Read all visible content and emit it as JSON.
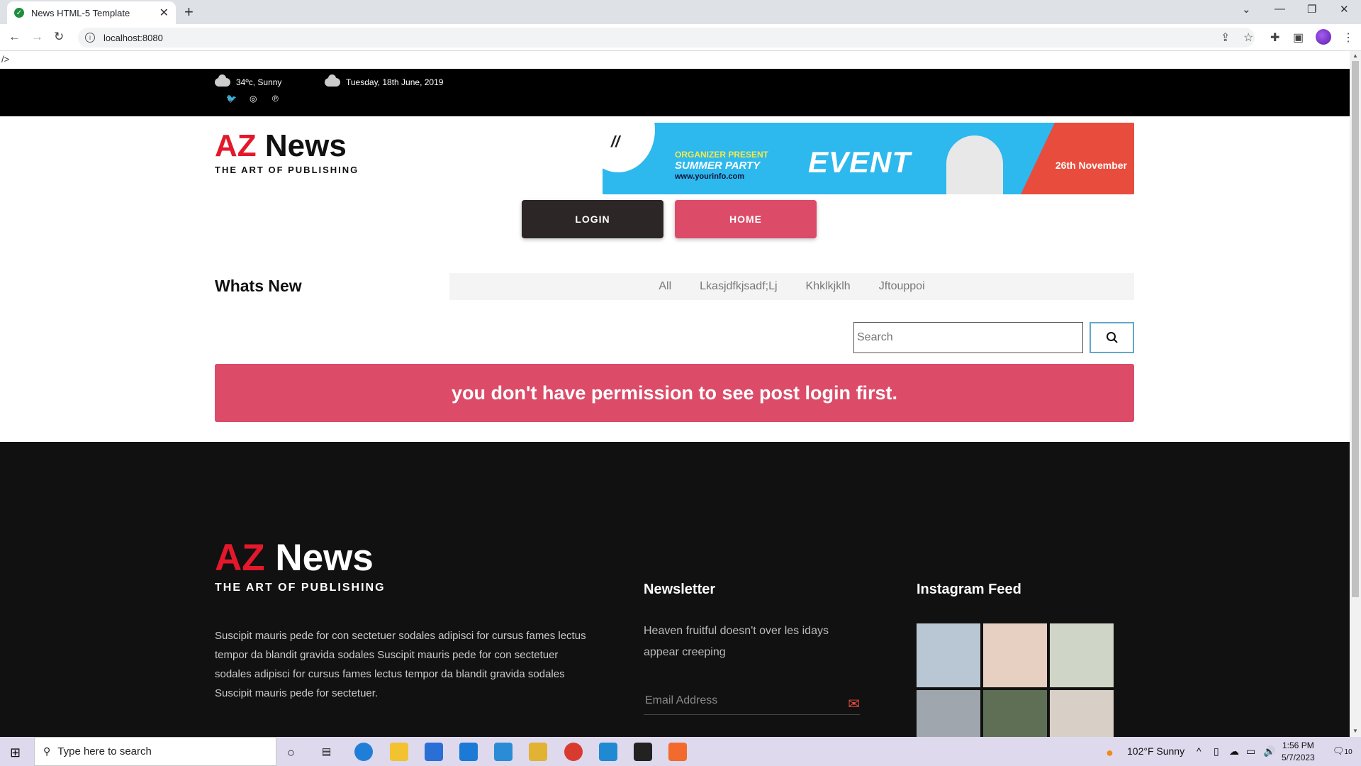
{
  "browser": {
    "tab_title": "News HTML-5 Template",
    "url": "localhost:8080"
  },
  "page": {
    "stray_text": "/>",
    "topbar": {
      "weather": "34ºc, Sunny",
      "date": "Tuesday, 18th June, 2019"
    },
    "logo": {
      "az": "AZ",
      "news": "News",
      "tagline": "THE ART OF PUBLISHING"
    },
    "banner": {
      "organizer": "ORGANIZER PRESENT",
      "party": "SUMMER PARTY",
      "url": "www.yourinfo.com",
      "event": "EVENT",
      "date": "26th November"
    },
    "buttons": {
      "login": "LOGIN",
      "home": "HOME"
    },
    "whats_new": {
      "title": "Whats New",
      "filters": [
        "All",
        "Lkasjdfkjsadf;Lj",
        "Khklkjklh",
        "Jftouppoi"
      ]
    },
    "search": {
      "placeholder": "Search"
    },
    "alert": "you don't have permission to see post login first.",
    "footer": {
      "logo_az": "AZ",
      "logo_news": "News",
      "tagline": "THE ART OF PUBLISHING",
      "description": "Suscipit mauris pede for con sectetuer sodales adipisci for cursus fames lectus tempor da blandit gravida sodales Suscipit mauris pede for con sectetuer sodales adipisci for cursus fames lectus tempor da blandit gravida sodales Suscipit mauris pede for sectetuer.",
      "newsletter_title": "Newsletter",
      "newsletter_text": "Heaven fruitful doesn't over les idays appear creeping",
      "email_placeholder": "Email Address",
      "instagram_title": "Instagram Feed",
      "instagram_colors": [
        "#b9c7d4",
        "#e7cfc1",
        "#cfd6c8",
        "#a0a6ae",
        "#5f6f56",
        "#d8cfc6"
      ]
    }
  },
  "taskbar": {
    "search_placeholder": "Type here to search",
    "weather": "102°F  Sunny",
    "time": "1:56 PM",
    "date": "5/7/2023",
    "notifications": "10"
  }
}
